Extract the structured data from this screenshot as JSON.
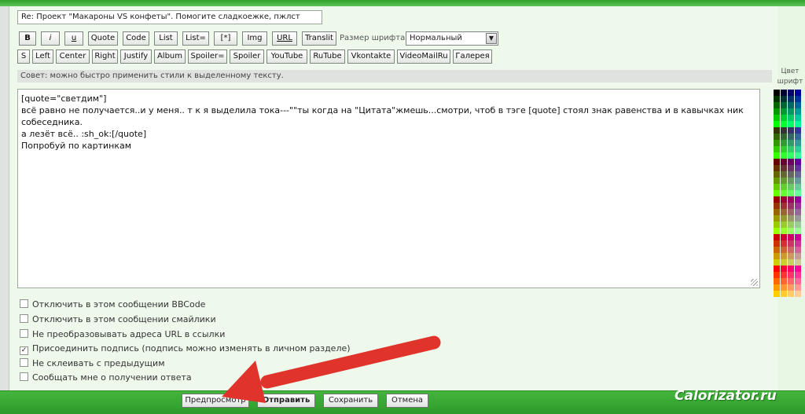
{
  "subject": {
    "value": "Re: Проект \"Макароны VS конфеты\". Помогите сладкоежке, пжлст"
  },
  "toolbar": {
    "row1": [
      "B",
      "i",
      "u",
      "Quote",
      "Code",
      "List",
      "List=",
      "[*]",
      "Img",
      "URL",
      "Translit"
    ],
    "row2": [
      "S",
      "Left",
      "Center",
      "Right",
      "Justify",
      "Album",
      "Spoiler=",
      "Spoiler",
      "YouTube",
      "RuTube",
      "Vkontakte",
      "VideoMailRu",
      "Галерея"
    ],
    "font_size_label": "Размер шрифта:",
    "font_size_value": "Нормальный"
  },
  "tip": "Совет: можно быстро применить стили к выделенному тексту.",
  "editor": {
    "lines": [
      "[quote=\"светдим\"]",
      "всё равно не получается..и у меня.. т к я выделила тока---\"\"ты когда на \"Цитата\"жмешь...смотри, чтоб в тэге [quote] стоял знак равенства и в кавычках ник собеседника.",
      "а лезёт всё.. :sh_ok:[/quote]",
      "Попробуй по картинкам"
    ]
  },
  "palette": {
    "label": "Цвет шрифт",
    "colors": [
      [
        "#000000",
        "#000033",
        "#000066",
        "#000099"
      ],
      [
        "#003300",
        "#003333",
        "#003366",
        "#003399"
      ],
      [
        "#006600",
        "#006633",
        "#006666",
        "#006699"
      ],
      [
        "#009900",
        "#009933",
        "#009966",
        "#009999"
      ],
      [
        "#00cc00",
        "#00cc33",
        "#00cc66",
        "#00cc99"
      ],
      [
        "#00ff00",
        "#00ff33",
        "#00ff66",
        "#00ff99"
      ],
      [
        "#333300",
        "#333333",
        "#333366",
        "#333399"
      ],
      [
        "#336600",
        "#336633",
        "#336666",
        "#336699"
      ],
      [
        "#339900",
        "#339933",
        "#339966",
        "#339999"
      ],
      [
        "#33cc00",
        "#33cc33",
        "#33cc66",
        "#33cc99"
      ],
      [
        "#33ff00",
        "#33ff33",
        "#33ff66",
        "#33ff99"
      ],
      [
        "#660000",
        "#660033",
        "#660066",
        "#660099"
      ],
      [
        "#663300",
        "#663333",
        "#663366",
        "#663399"
      ],
      [
        "#666600",
        "#666633",
        "#666666",
        "#666699"
      ],
      [
        "#669900",
        "#669933",
        "#669966",
        "#669999"
      ],
      [
        "#66cc00",
        "#66cc33",
        "#66cc66",
        "#66cc99"
      ],
      [
        "#66ff00",
        "#66ff33",
        "#66ff66",
        "#66ff99"
      ],
      [
        "#990000",
        "#990033",
        "#990066",
        "#990099"
      ],
      [
        "#993300",
        "#993333",
        "#993366",
        "#993399"
      ],
      [
        "#996600",
        "#996633",
        "#996666",
        "#996699"
      ],
      [
        "#999900",
        "#999933",
        "#999966",
        "#999999"
      ],
      [
        "#99cc00",
        "#99cc33",
        "#99cc66",
        "#99cc99"
      ],
      [
        "#99ff00",
        "#99ff33",
        "#99ff66",
        "#99ff99"
      ],
      [
        "#cc0000",
        "#cc0033",
        "#cc0066",
        "#cc0099"
      ],
      [
        "#cc3300",
        "#cc3333",
        "#cc3366",
        "#cc3399"
      ],
      [
        "#cc6600",
        "#cc6633",
        "#cc6666",
        "#cc6699"
      ],
      [
        "#cc9900",
        "#cc9933",
        "#cc9966",
        "#cc9999"
      ],
      [
        "#cccc00",
        "#cccc33",
        "#cccc66",
        "#cccc99"
      ],
      [
        "#ff0000",
        "#ff0033",
        "#ff0066",
        "#ff0099"
      ],
      [
        "#ff3300",
        "#ff3333",
        "#ff3366",
        "#ff3399"
      ],
      [
        "#ff6600",
        "#ff6633",
        "#ff6666",
        "#ff6699"
      ],
      [
        "#ff9900",
        "#ff9933",
        "#ff9966",
        "#ff9999"
      ],
      [
        "#ffcc00",
        "#ffcc33",
        "#ffcc66",
        "#ffcc99"
      ]
    ]
  },
  "options": [
    {
      "label": "Отключить в этом сообщении BBCode",
      "checked": false
    },
    {
      "label": "Отключить в этом сообщении смайлики",
      "checked": false
    },
    {
      "label": "Не преобразовывать адреса URL в ссылки",
      "checked": false
    },
    {
      "label": "Присоединить подпись (подпись можно изменять в личном разделе)",
      "checked": true
    },
    {
      "label": "Не склеивать с предыдущим",
      "checked": false
    },
    {
      "label": "Сообщать мне о получении ответа",
      "checked": false
    }
  ],
  "actions": {
    "preview": "Предпросмотр",
    "submit": "Отправить",
    "save": "Сохранить",
    "cancel": "Отмена"
  },
  "watermark": "Calorizator.ru",
  "colors": {
    "accent_green": "#2e9a29",
    "annotation_arrow": "#e0332b"
  }
}
